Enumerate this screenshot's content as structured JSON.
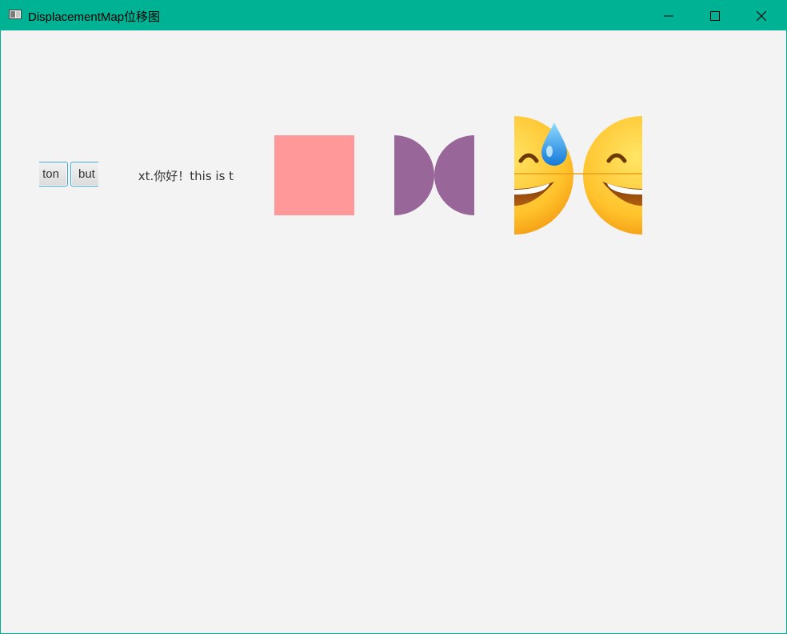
{
  "window": {
    "title": "DisplacementMap位移图",
    "accent_color": "#00b294",
    "controls": {
      "minimize_icon": "minimize-icon",
      "maximize_icon": "maximize-icon",
      "close_icon": "close-icon"
    }
  },
  "content": {
    "button_1_label": "ton",
    "button_2_label": "but",
    "text_label": "xt.你好！this is te",
    "shapes": {
      "rectangle_color": "#ff9999",
      "bowtie_color": "#996699"
    },
    "emoji": "grinning-face-with-sweat-icon"
  }
}
